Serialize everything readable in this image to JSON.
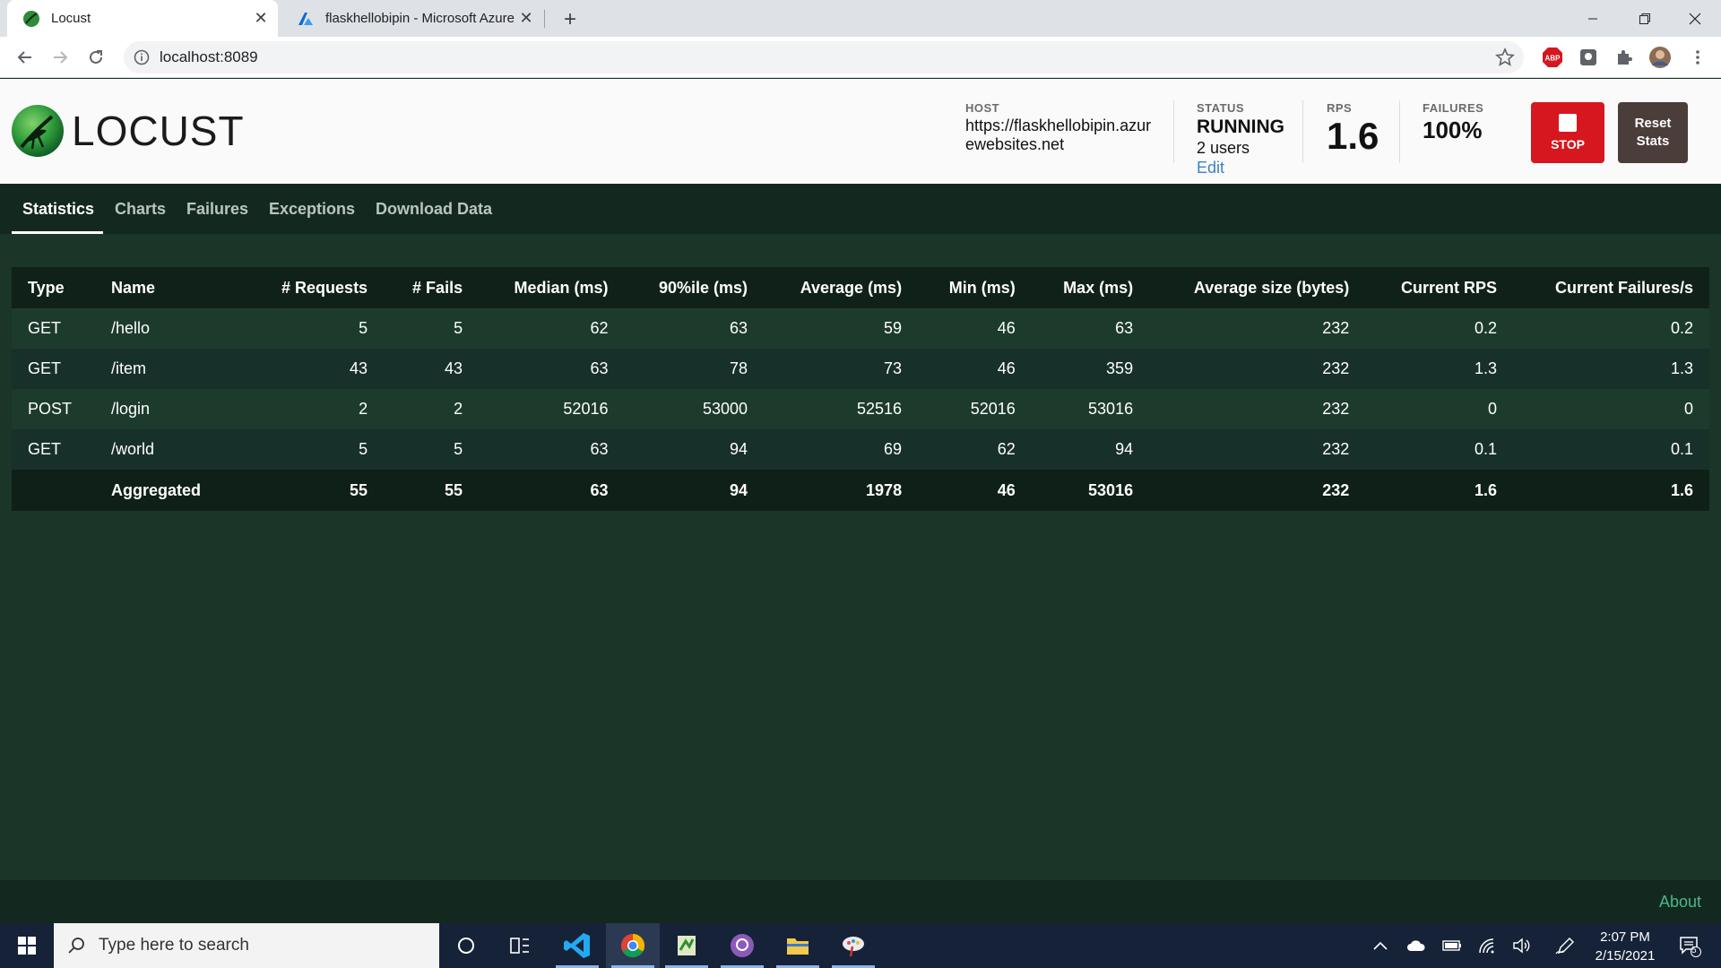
{
  "browser": {
    "tabs": [
      {
        "title": "Locust",
        "active": true
      },
      {
        "title": "flaskhellobipin - Microsoft Azure",
        "active": false
      }
    ],
    "new_tab_label": "+",
    "url": "localhost:8089"
  },
  "locust": {
    "logo_text": "LOCUST",
    "host": {
      "label": "HOST",
      "value": "https://flaskhellobipin.azurewebsites.net"
    },
    "status": {
      "label": "STATUS",
      "value": "RUNNING",
      "users": "2 users",
      "edit": "Edit"
    },
    "rps": {
      "label": "RPS",
      "value": "1.6"
    },
    "failures": {
      "label": "FAILURES",
      "value": "100%"
    },
    "stop_label": "STOP",
    "reset_label": "Reset Stats"
  },
  "nav": {
    "tabs": [
      "Statistics",
      "Charts",
      "Failures",
      "Exceptions",
      "Download Data"
    ],
    "active": "Statistics"
  },
  "table": {
    "headers": [
      "Type",
      "Name",
      "# Requests",
      "# Fails",
      "Median (ms)",
      "90%ile (ms)",
      "Average (ms)",
      "Min (ms)",
      "Max (ms)",
      "Average size (bytes)",
      "Current RPS",
      "Current Failures/s"
    ],
    "rows": [
      [
        "GET",
        "/hello",
        "5",
        "5",
        "62",
        "63",
        "59",
        "46",
        "63",
        "232",
        "0.2",
        "0.2"
      ],
      [
        "GET",
        "/item",
        "43",
        "43",
        "63",
        "78",
        "73",
        "46",
        "359",
        "232",
        "1.3",
        "1.3"
      ],
      [
        "POST",
        "/login",
        "2",
        "2",
        "52016",
        "53000",
        "52516",
        "52016",
        "53016",
        "232",
        "0",
        "0"
      ],
      [
        "GET",
        "/world",
        "5",
        "5",
        "63",
        "94",
        "69",
        "62",
        "94",
        "232",
        "0.1",
        "0.1"
      ]
    ],
    "aggregate": [
      "",
      "Aggregated",
      "55",
      "55",
      "63",
      "94",
      "1978",
      "46",
      "53016",
      "232",
      "1.6",
      "1.6"
    ]
  },
  "footer": {
    "about": "About"
  },
  "taskbar": {
    "search_placeholder": "Type here to search",
    "time": "2:07 PM",
    "date": "2/15/2021",
    "notification_count": "5"
  },
  "colors": {
    "brand_green": "#1b3528",
    "stop_red": "#d6171f",
    "reset_brown": "#4a3d3a",
    "link_blue": "#3b82c4",
    "about_green": "#49b88a"
  }
}
